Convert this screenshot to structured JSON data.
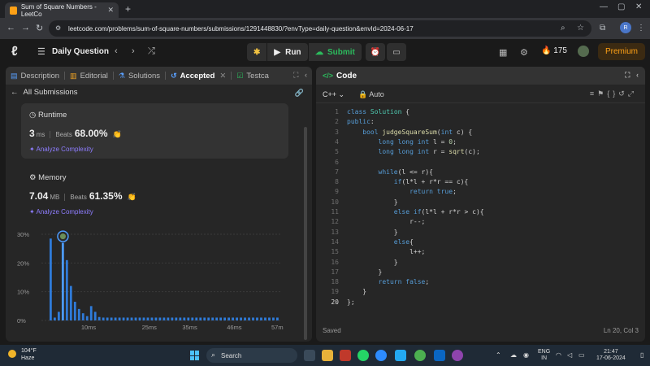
{
  "browser": {
    "tab_title": "Sum of Square Numbers - LeetCo",
    "url": "leetcode.com/problems/sum-of-square-numbers/submissions/1291448830/?envType=daily-question&envId=2024-06-17",
    "profile_initial": "R"
  },
  "header": {
    "title": "Daily Question",
    "run_label": "Run",
    "submit_label": "Submit",
    "streak": "175",
    "premium_label": "Premium"
  },
  "left_panel": {
    "tabs": [
      {
        "label": "Description",
        "icon": "document-icon"
      },
      {
        "label": "Editorial",
        "icon": "book-icon"
      },
      {
        "label": "Solutions",
        "icon": "flask-icon"
      },
      {
        "label": "Accepted",
        "icon": "history-icon"
      },
      {
        "label": "Testca",
        "icon": "checkbox-icon"
      }
    ],
    "back_label": "All Submissions",
    "runtime": {
      "title": "Runtime",
      "value": "3",
      "unit": "ms",
      "beats_label": "Beats",
      "beats": "68.00%",
      "analyze": "Analyze Complexity"
    },
    "memory": {
      "title": "Memory",
      "value": "7.04",
      "unit": "MB",
      "beats_label": "Beats",
      "beats": "61.35%",
      "analyze": "Analyze Complexity"
    }
  },
  "chart_data": {
    "type": "bar",
    "yticks": [
      "0%",
      "10%",
      "20%",
      "30%"
    ],
    "xticks": [
      "10ms",
      "25ms",
      "35ms",
      "46ms",
      "57ms"
    ],
    "ylim": [
      0,
      30
    ],
    "x": [
      1,
      2,
      3,
      4,
      5,
      6,
      7,
      8,
      9,
      10,
      11,
      12,
      13,
      14,
      15,
      16,
      17,
      18,
      19,
      20,
      21,
      22,
      23,
      24,
      25,
      26,
      27,
      28,
      29,
      30,
      31,
      32,
      33,
      34,
      35,
      36,
      37,
      38,
      39,
      40,
      41,
      42,
      43,
      44,
      45,
      46,
      47,
      48,
      49,
      50,
      51,
      52,
      53,
      54,
      55,
      56,
      57
    ],
    "values": [
      28.5,
      1.0,
      3.0,
      27.0,
      21.0,
      12.0,
      6.5,
      4.0,
      2.5,
      1.5,
      5.0,
      3.0,
      1.2,
      1.0,
      1.0,
      1.0,
      1.0,
      1.0,
      1.0,
      1.0,
      1.0,
      1.0,
      1.0,
      1.0,
      1.0,
      1.0,
      1.0,
      1.0,
      1.0,
      1.0,
      1.0,
      1.0,
      1.0,
      1.0,
      1.0,
      1.0,
      1.0,
      1.0,
      1.0,
      1.0,
      1.0,
      1.0,
      1.0,
      1.0,
      1.0,
      1.0,
      1.0,
      1.0,
      1.0,
      1.0,
      1.0,
      1.0,
      1.0,
      1.0,
      1.0,
      1.0,
      1.0
    ],
    "highlight_index": 3,
    "colors": {
      "bar": "#2f7bd9",
      "highlight": "#4c9bff"
    }
  },
  "editor": {
    "title": "Code",
    "language": "C++",
    "mode": "Auto",
    "status": "Saved",
    "cursor": "Ln 20, Col 3",
    "lines": [
      "class Solution {",
      "public:",
      "    bool judgeSquareSum(int c) {",
      "        long long int l = 0;",
      "        long long int r = sqrt(c);",
      "",
      "        while(l <= r){",
      "            if(l*l + r*r == c){",
      "                return true;",
      "            }",
      "            else if(l*l + r*r > c){",
      "                r--;",
      "            }",
      "            else{",
      "                l++;",
      "            }",
      "        }",
      "        return false;",
      "    }",
      "};"
    ]
  },
  "taskbar": {
    "temperature": "104°F",
    "weather": "Haze",
    "search_placeholder": "Search",
    "lang_line1": "ENG",
    "lang_line2": "IN",
    "time": "21:47",
    "date": "17-06-2024"
  }
}
